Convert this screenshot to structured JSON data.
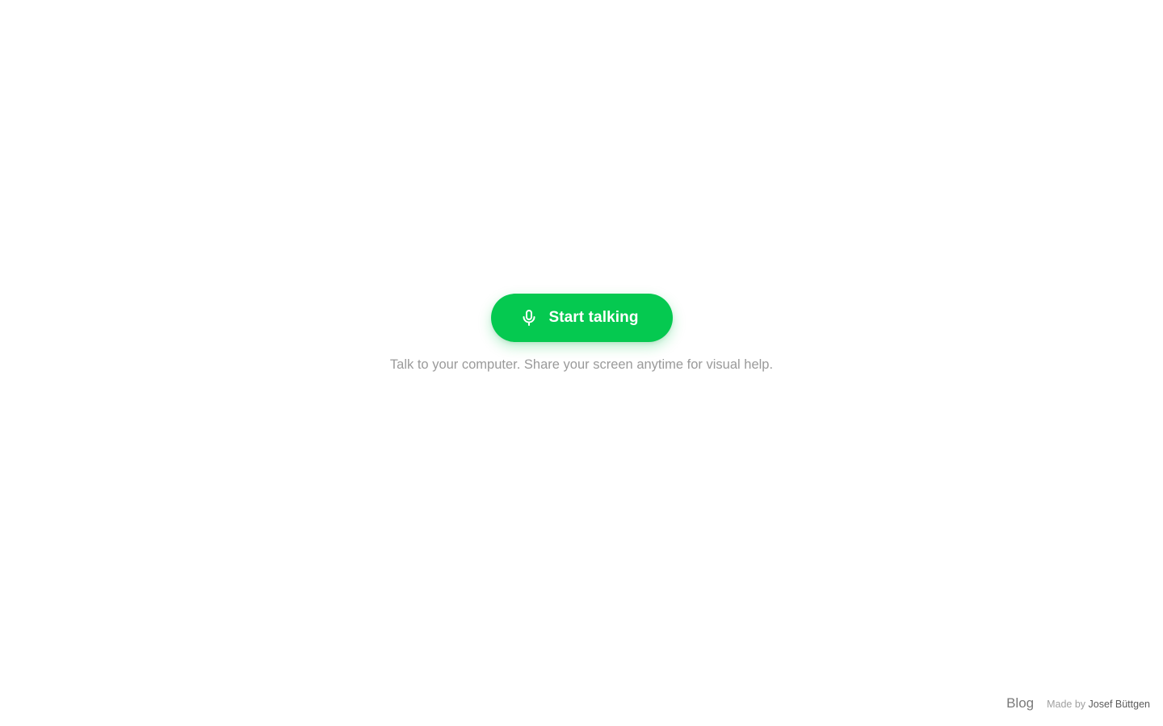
{
  "main": {
    "start_button": {
      "label": "Start talking",
      "icon": "microphone-icon",
      "color": "#05c950"
    },
    "tagline": "Talk to your computer. Share your screen anytime for visual help."
  },
  "footer": {
    "blog_label": "Blog",
    "made_by_prefix": "Made by",
    "author_name": "Josef Büttgen"
  }
}
